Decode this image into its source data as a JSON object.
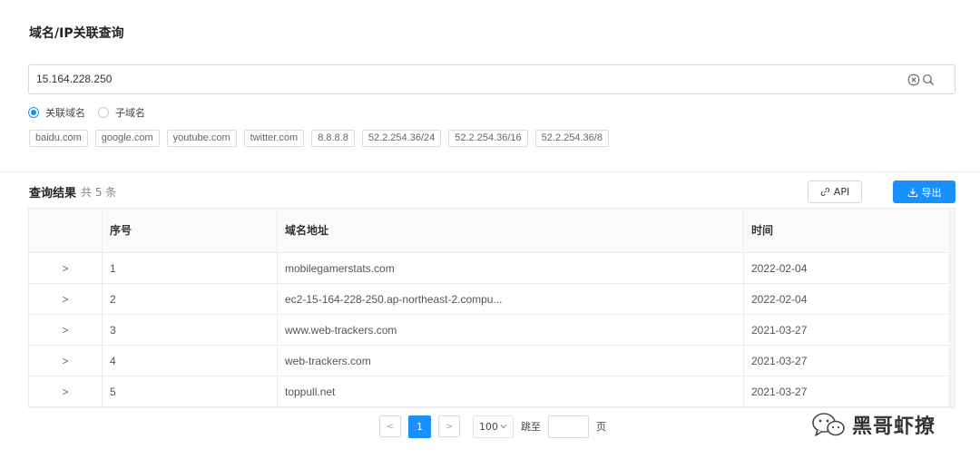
{
  "header": {
    "title": "域名/IP关联查询"
  },
  "search": {
    "value": "15.164.228.250"
  },
  "radios": [
    {
      "label": "关联域名",
      "checked": true
    },
    {
      "label": "子域名",
      "checked": false
    }
  ],
  "chips": [
    "baidu.com",
    "google.com",
    "youtube.com",
    "twitter.com",
    "8.8.8.8",
    "52.2.254.36/24",
    "52.2.254.36/16",
    "52.2.254.36/8"
  ],
  "results": {
    "title": "查询结果",
    "count_text": "共 5 条",
    "api_label": "API",
    "export_label": "导出"
  },
  "table": {
    "columns": [
      "",
      "序号",
      "域名地址",
      "时间"
    ],
    "expand_symbol": ">",
    "rows": [
      {
        "index": "1",
        "domain": "mobilegamerstats.com",
        "time": "2022-02-04"
      },
      {
        "index": "2",
        "domain": "ec2-15-164-228-250.ap-northeast-2.compu...",
        "time": "2022-02-04"
      },
      {
        "index": "3",
        "domain": "www.web-trackers.com",
        "time": "2021-03-27"
      },
      {
        "index": "4",
        "domain": "web-trackers.com",
        "time": "2021-03-27"
      },
      {
        "index": "5",
        "domain": "toppull.net",
        "time": "2021-03-27"
      }
    ]
  },
  "pagination": {
    "prev": "<",
    "current": "1",
    "next": ">",
    "page_size": "100",
    "jump_label": "跳至",
    "page_label": "页"
  },
  "watermark": {
    "text": "黑哥虾撩"
  },
  "colors": {
    "accent": "#1890ff"
  }
}
